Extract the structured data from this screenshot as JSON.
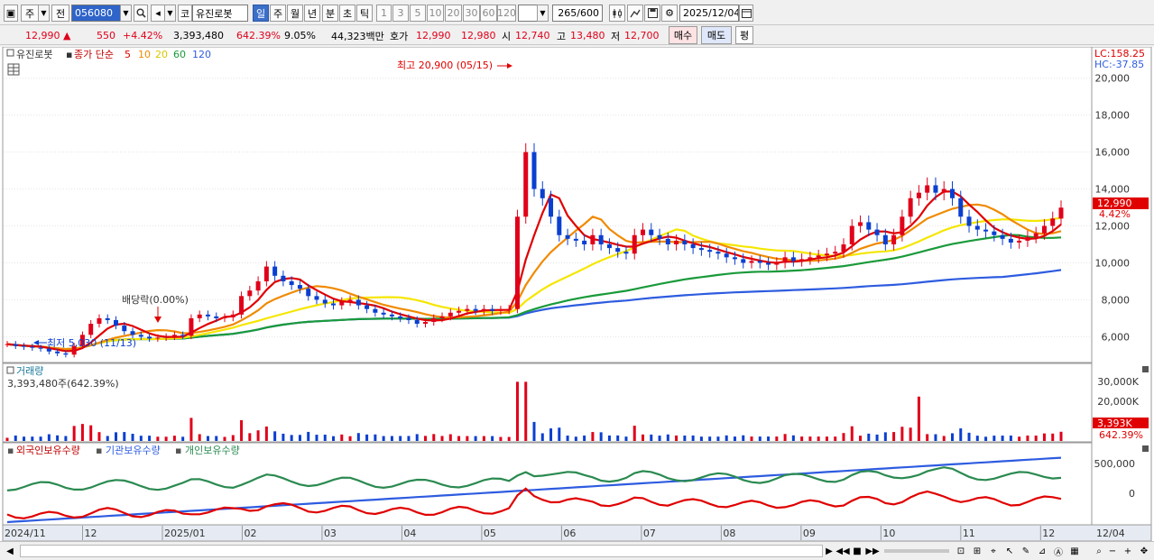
{
  "toolbar": {
    "period_label": "주",
    "prev_label": "전",
    "stock_code": "056080",
    "market_label": "코",
    "stock_name": "유진로봇",
    "period_tabs": [
      "일",
      "주",
      "월",
      "년",
      "분",
      "초",
      "틱"
    ],
    "active_period": "일",
    "interval_buttons": [
      "1",
      "3",
      "5",
      "10",
      "20",
      "30",
      "60",
      "120"
    ],
    "count": "265",
    "count_max": "/600",
    "date": "2025/12/04"
  },
  "pricebar": {
    "price": "12,990",
    "change": "550",
    "change_pct": "+4.42%",
    "volume": "3,393,480",
    "volume_ratio": "642.39%",
    "turnover": "9.05%",
    "amount": "44,323백만",
    "quote_label": "호가",
    "ask": "12,990",
    "bid": "12,980",
    "open_label": "시",
    "open": "12,740",
    "high_label": "고",
    "high": "13,480",
    "low_label": "저",
    "low": "12,700",
    "buy_label": "매수",
    "sell_label": "매도",
    "eval_label": "평"
  },
  "price_panel": {
    "stock_label": "유진로봇",
    "indicator_label": "종가 단순",
    "ma_periods": [
      "5",
      "10",
      "20",
      "60",
      "120"
    ],
    "lc": "LC:158.25",
    "hc": "HC:-37.85",
    "high_annotation": "최고 20,900 (05/15)",
    "low_annotation": "최저 5,030 (11/13)",
    "dividend_annotation": "배당락(0.00%)",
    "current_price_tag": "12,990",
    "current_pct_tag": "4.42%"
  },
  "volume_panel": {
    "title": "거래량",
    "value": "3,393,480주(642.39%)",
    "current_tag": "3,393K",
    "current_pct": "642.39%"
  },
  "holdings_panel": {
    "series": [
      "외국인보유수량",
      "기관보유수량",
      "개인보유수량"
    ]
  },
  "x_axis_labels": [
    "2024/11",
    "12",
    "2025/01",
    "02",
    "03",
    "04",
    "05",
    "06",
    "07",
    "08",
    "09",
    "10",
    "11",
    "12",
    "12/04"
  ],
  "chart_data": [
    {
      "type": "candlestick",
      "y_axis_ticks": [
        6000,
        8000,
        10000,
        12000,
        14000,
        16000,
        18000,
        20000
      ],
      "ylim": [
        4700,
        21500
      ],
      "closes": [
        5600,
        5500,
        5450,
        5400,
        5350,
        5200,
        5100,
        5030,
        5500,
        6100,
        6700,
        7000,
        6900,
        6600,
        6300,
        6100,
        6000,
        5900,
        5950,
        6000,
        6100,
        6050,
        7000,
        7200,
        7100,
        7000,
        7050,
        7200,
        8200,
        8500,
        9000,
        9800,
        9300,
        9000,
        8800,
        8600,
        8200,
        8000,
        7800,
        7700,
        7900,
        8000,
        7700,
        7500,
        7300,
        7200,
        7100,
        7000,
        6900,
        6700,
        6800,
        7000,
        7100,
        7300,
        7400,
        7500,
        7400,
        7500,
        7400,
        7450,
        7500,
        12500,
        16000,
        14000,
        13500,
        12500,
        11500,
        11300,
        11200,
        11000,
        11500,
        11000,
        10800,
        10600,
        10500,
        11500,
        11800,
        11500,
        11300,
        11000,
        11200,
        11000,
        10800,
        10700,
        10600,
        10500,
        10300,
        10200,
        10000,
        10100,
        10000,
        9900,
        10000,
        10300,
        10100,
        10200,
        10300,
        10400,
        10500,
        10600,
        11000,
        12000,
        12200,
        11800,
        11500,
        11000,
        11500,
        12500,
        13500,
        13800,
        14200,
        13800,
        14000,
        13500,
        12500,
        12000,
        11800,
        11700,
        11500,
        11300,
        11100,
        11200,
        11400,
        11600,
        12000,
        12400,
        12990
      ],
      "volume_unit": "K shares",
      "volume_axis_ticks": [
        "30,000K",
        "20,000K"
      ],
      "holdings_axis_ticks": [
        "500,000",
        "0"
      ]
    }
  ],
  "colors": {
    "up": "#e0001a",
    "down": "#0a3fd0",
    "ma5": "#e00000",
    "ma10": "#f08a00",
    "ma20": "#f5e600",
    "ma60": "#1a9a3a",
    "ma120": "#2e5ce0",
    "foreign": "#e00000",
    "institution": "#2e5ce0",
    "individual": "#2a8a50"
  }
}
